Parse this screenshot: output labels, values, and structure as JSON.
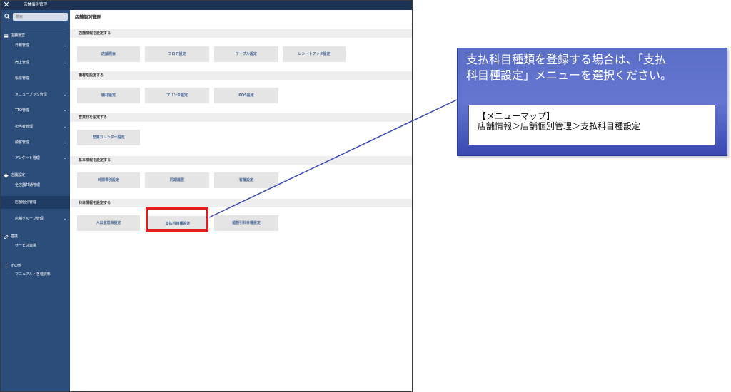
{
  "window": {
    "title": "店舗個別管理",
    "close_glyph": "✕"
  },
  "sidebar": {
    "search_placeholder": "検索",
    "sections": [
      {
        "icon": "store-icon",
        "label": "店舗運営"
      },
      {
        "icon": "gear-icon",
        "label": "店舗設定"
      },
      {
        "icon": "link-icon",
        "label": "連携"
      },
      {
        "icon": "info-icon",
        "label": "その他"
      }
    ],
    "items": [
      {
        "label": "日報管理",
        "caret": "⌄"
      },
      {
        "label": "売上管理",
        "caret": "⌄"
      },
      {
        "label": "帳票管理",
        "caret": ""
      },
      {
        "label": "メニューブック管理",
        "caret": "⌄"
      },
      {
        "label": "TTO管理",
        "caret": "⌄"
      },
      {
        "label": "担当者管理",
        "caret": "⌄"
      },
      {
        "label": "顧客管理",
        "caret": "⌄"
      },
      {
        "label": "アンケート管理",
        "caret": "⌄"
      },
      {
        "label": "全店舗共通管理",
        "caret": ""
      },
      {
        "label": "店舗個別管理",
        "caret": "",
        "active": true
      },
      {
        "label": "店舗グループ管理",
        "caret": "⌄"
      },
      {
        "label": "サービス連携",
        "caret": ""
      },
      {
        "label": "マニュアル・各種資料",
        "caret": ""
      }
    ]
  },
  "main": {
    "title": "店舗個別管理",
    "sections": [
      {
        "heading": "店舗情報を設定する",
        "buttons": [
          "店舗照会",
          "フロア設定",
          "テーブル設定",
          "レシートフッタ設定"
        ]
      },
      {
        "heading": "機材を設定する",
        "buttons": [
          "機材設定",
          "プリンタ設定",
          "POS設定"
        ]
      },
      {
        "heading": "営業日を設定する",
        "buttons": [
          "営業カレンダー設定"
        ]
      },
      {
        "heading": "基本情報を設定する",
        "buttons": [
          "時間帯別設定",
          "同期履歴",
          "客層設定"
        ]
      },
      {
        "heading": "科目情報を設定する",
        "buttons": [
          "入出金理由設定",
          "支払科目種設定",
          "値割引科目種設定"
        ]
      }
    ]
  },
  "callout": {
    "line1": "支払科目種類を登録する場合は、「支払",
    "line2": "科目種設定」メニューを選択ください。",
    "map_title": "【メニューマップ】",
    "map_path": "店舗情報＞店舗個別管理＞支払科目種設定"
  },
  "colors": {
    "topbar": "#1e3254",
    "sidebar": "#2c4d7a",
    "sidebar_active": "#1f3b63",
    "tile": "#e5e5e5",
    "tile_text": "#4a6a96",
    "highlight": "#e02020",
    "callout": "#5a6ec8",
    "connector": "#3a48b0"
  }
}
